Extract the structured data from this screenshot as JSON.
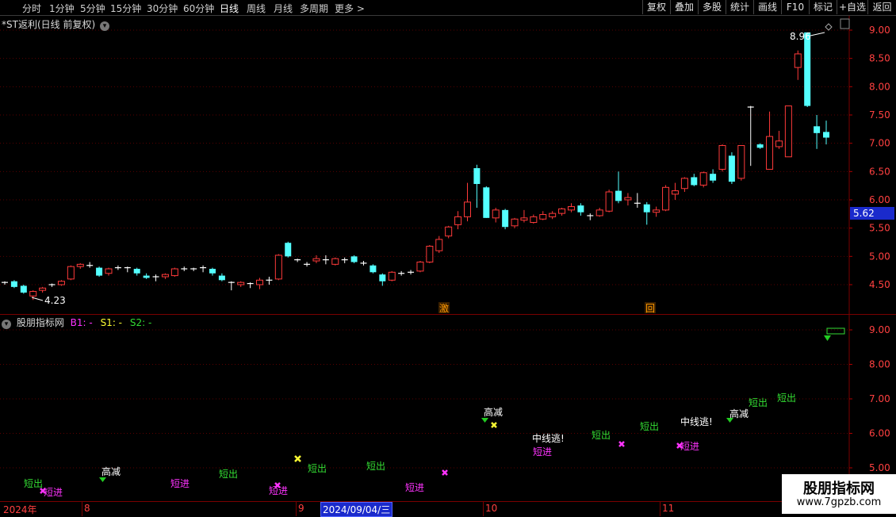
{
  "toolbar": {
    "timeframes": [
      "分时",
      "1分钟",
      "5分钟",
      "15分钟",
      "30分钟",
      "60分钟",
      "日线",
      "周线",
      "月线",
      "多周期",
      "更多 >"
    ],
    "active_timeframe": "日线",
    "buttons": [
      "复权",
      "叠加",
      "多股",
      "统计",
      "画线",
      "F10",
      "标记",
      "+自选",
      "返回"
    ]
  },
  "main_chart": {
    "title": "*ST返利(日线 前复权)",
    "price_ticks": [
      "9.00",
      "8.50",
      "8.00",
      "7.50",
      "7.00",
      "6.50",
      "6.00",
      "5.50",
      "5.00",
      "4.50"
    ],
    "current_price_label": "5.62",
    "high_annotation": "8.96",
    "low_annotation": "4.23",
    "markers": [
      {
        "text": "激",
        "color": "#ff9900"
      },
      {
        "text": "回",
        "color": "#ff9900"
      }
    ]
  },
  "sub_chart": {
    "name": "股朋指标网",
    "b1_label": "B1: -",
    "s1_label": "S1: -",
    "s2_label": "S2: -",
    "ticks": [
      "9.00",
      "8.00",
      "7.00",
      "6.00",
      "5.00"
    ],
    "signals": [
      {
        "text": "短出",
        "color": "#33dd33"
      },
      {
        "text": "短进",
        "color": "#ff33ff"
      },
      {
        "text": "高减",
        "color": "#ffffff"
      },
      {
        "text": "短进",
        "color": "#ff33ff"
      },
      {
        "text": "短出",
        "color": "#33dd33"
      },
      {
        "text": "短进",
        "color": "#ff33ff"
      },
      {
        "text": "短出",
        "color": "#33dd33"
      },
      {
        "text": "短出",
        "color": "#33dd33"
      },
      {
        "text": "短进",
        "color": "#ff33ff"
      },
      {
        "text": "高减",
        "color": "#ffffff"
      },
      {
        "text": "中线逃!",
        "color": "#ffffff"
      },
      {
        "text": "短进",
        "color": "#ff33ff"
      },
      {
        "text": "短出",
        "color": "#33dd33"
      },
      {
        "text": "短出",
        "color": "#33dd33"
      },
      {
        "text": "中线逃!",
        "color": "#ffffff"
      },
      {
        "text": "短进",
        "color": "#ff33ff"
      },
      {
        "text": "高减",
        "color": "#ffffff"
      },
      {
        "text": "短出",
        "color": "#33dd33"
      },
      {
        "text": "短出",
        "color": "#33dd33"
      }
    ]
  },
  "date_axis": {
    "labels": [
      "2024年",
      "8",
      "9",
      "2024/09/04/三",
      "10",
      "11"
    ]
  },
  "watermark": {
    "title": "股朋指标网",
    "url": "www.7gpzb.com"
  },
  "chart_data": {
    "type": "candlestick",
    "ylim": [
      4.2,
      9.2
    ],
    "candles": [
      {
        "o": 4.52,
        "h": 4.56,
        "l": 4.5,
        "c": 4.54
      },
      {
        "o": 4.56,
        "h": 4.58,
        "l": 4.44,
        "c": 4.46
      },
      {
        "o": 4.48,
        "h": 4.5,
        "l": 4.34,
        "c": 4.36
      },
      {
        "o": 4.3,
        "h": 4.4,
        "l": 4.23,
        "c": 4.38
      },
      {
        "o": 4.4,
        "h": 4.46,
        "l": 4.36,
        "c": 4.44
      },
      {
        "o": 4.48,
        "h": 4.52,
        "l": 4.46,
        "c": 4.5
      },
      {
        "o": 4.5,
        "h": 4.58,
        "l": 4.48,
        "c": 4.56
      },
      {
        "o": 4.6,
        "h": 4.84,
        "l": 4.58,
        "c": 4.82
      },
      {
        "o": 4.82,
        "h": 4.88,
        "l": 4.78,
        "c": 4.86
      },
      {
        "o": 4.84,
        "h": 4.9,
        "l": 4.8,
        "c": 4.84
      },
      {
        "o": 4.8,
        "h": 4.82,
        "l": 4.64,
        "c": 4.66
      },
      {
        "o": 4.7,
        "h": 4.8,
        "l": 4.66,
        "c": 4.78
      },
      {
        "o": 4.8,
        "h": 4.84,
        "l": 4.76,
        "c": 4.78
      },
      {
        "o": 4.78,
        "h": 4.82,
        "l": 4.72,
        "c": 4.8
      },
      {
        "o": 4.78,
        "h": 4.8,
        "l": 4.66,
        "c": 4.7
      },
      {
        "o": 4.66,
        "h": 4.7,
        "l": 4.6,
        "c": 4.62
      },
      {
        "o": 4.64,
        "h": 4.68,
        "l": 4.56,
        "c": 4.64
      },
      {
        "o": 4.64,
        "h": 4.7,
        "l": 4.6,
        "c": 4.68
      },
      {
        "o": 4.66,
        "h": 4.8,
        "l": 4.64,
        "c": 4.78
      },
      {
        "o": 4.78,
        "h": 4.82,
        "l": 4.74,
        "c": 4.76
      },
      {
        "o": 4.78,
        "h": 4.8,
        "l": 4.74,
        "c": 4.78
      },
      {
        "o": 4.78,
        "h": 4.84,
        "l": 4.72,
        "c": 4.8
      },
      {
        "o": 4.78,
        "h": 4.8,
        "l": 4.66,
        "c": 4.7
      },
      {
        "o": 4.66,
        "h": 4.7,
        "l": 4.56,
        "c": 4.58
      },
      {
        "o": 4.54,
        "h": 4.56,
        "l": 4.4,
        "c": 4.54
      },
      {
        "o": 4.5,
        "h": 4.56,
        "l": 4.46,
        "c": 4.54
      },
      {
        "o": 4.5,
        "h": 4.54,
        "l": 4.44,
        "c": 4.52
      },
      {
        "o": 4.5,
        "h": 4.62,
        "l": 4.42,
        "c": 4.58
      },
      {
        "o": 4.58,
        "h": 4.64,
        "l": 4.5,
        "c": 4.58
      },
      {
        "o": 4.6,
        "h": 5.04,
        "l": 4.58,
        "c": 5.02
      },
      {
        "o": 5.24,
        "h": 5.26,
        "l": 4.98,
        "c": 5.0
      },
      {
        "o": 4.94,
        "h": 4.96,
        "l": 4.9,
        "c": 4.94
      },
      {
        "o": 4.84,
        "h": 4.9,
        "l": 4.82,
        "c": 4.86
      },
      {
        "o": 4.92,
        "h": 5.02,
        "l": 4.88,
        "c": 4.96
      },
      {
        "o": 4.94,
        "h": 5.02,
        "l": 4.86,
        "c": 4.94
      },
      {
        "o": 4.86,
        "h": 4.98,
        "l": 4.84,
        "c": 4.96
      },
      {
        "o": 4.92,
        "h": 4.98,
        "l": 4.88,
        "c": 4.94
      },
      {
        "o": 5.0,
        "h": 5.02,
        "l": 4.88,
        "c": 4.9
      },
      {
        "o": 4.88,
        "h": 4.92,
        "l": 4.84,
        "c": 4.86
      },
      {
        "o": 4.84,
        "h": 4.86,
        "l": 4.7,
        "c": 4.72
      },
      {
        "o": 4.68,
        "h": 4.7,
        "l": 4.48,
        "c": 4.56
      },
      {
        "o": 4.58,
        "h": 4.74,
        "l": 4.56,
        "c": 4.72
      },
      {
        "o": 4.7,
        "h": 4.74,
        "l": 4.66,
        "c": 4.7
      },
      {
        "o": 4.7,
        "h": 4.76,
        "l": 4.68,
        "c": 4.72
      },
      {
        "o": 4.74,
        "h": 4.92,
        "l": 4.72,
        "c": 4.9
      },
      {
        "o": 4.9,
        "h": 5.2,
        "l": 4.88,
        "c": 5.18
      },
      {
        "o": 5.1,
        "h": 5.36,
        "l": 5.06,
        "c": 5.3
      },
      {
        "o": 5.36,
        "h": 5.54,
        "l": 5.32,
        "c": 5.52
      },
      {
        "o": 5.56,
        "h": 5.8,
        "l": 5.48,
        "c": 5.7
      },
      {
        "o": 5.7,
        "h": 6.3,
        "l": 5.62,
        "c": 5.96
      },
      {
        "o": 6.56,
        "h": 6.62,
        "l": 5.86,
        "c": 6.28
      },
      {
        "o": 6.22,
        "h": 6.24,
        "l": 5.68,
        "c": 5.68
      },
      {
        "o": 5.68,
        "h": 5.86,
        "l": 5.6,
        "c": 5.82
      },
      {
        "o": 5.82,
        "h": 5.84,
        "l": 5.48,
        "c": 5.52
      },
      {
        "o": 5.54,
        "h": 5.68,
        "l": 5.5,
        "c": 5.66
      },
      {
        "o": 5.64,
        "h": 5.82,
        "l": 5.6,
        "c": 5.68
      },
      {
        "o": 5.6,
        "h": 5.74,
        "l": 5.58,
        "c": 5.7
      },
      {
        "o": 5.66,
        "h": 5.8,
        "l": 5.64,
        "c": 5.74
      },
      {
        "o": 5.7,
        "h": 5.8,
        "l": 5.66,
        "c": 5.76
      },
      {
        "o": 5.76,
        "h": 5.86,
        "l": 5.72,
        "c": 5.84
      },
      {
        "o": 5.82,
        "h": 5.94,
        "l": 5.78,
        "c": 5.88
      },
      {
        "o": 5.9,
        "h": 5.94,
        "l": 5.72,
        "c": 5.78
      },
      {
        "o": 5.72,
        "h": 5.76,
        "l": 5.64,
        "c": 5.72
      },
      {
        "o": 5.72,
        "h": 5.86,
        "l": 5.7,
        "c": 5.82
      },
      {
        "o": 5.8,
        "h": 6.18,
        "l": 5.78,
        "c": 6.14
      },
      {
        "o": 6.16,
        "h": 6.5,
        "l": 5.94,
        "c": 5.98
      },
      {
        "o": 6.0,
        "h": 6.12,
        "l": 5.9,
        "c": 6.04
      },
      {
        "o": 5.94,
        "h": 6.12,
        "l": 5.86,
        "c": 5.94
      },
      {
        "o": 5.92,
        "h": 5.96,
        "l": 5.56,
        "c": 5.78
      },
      {
        "o": 5.78,
        "h": 5.88,
        "l": 5.7,
        "c": 5.82
      },
      {
        "o": 5.82,
        "h": 6.26,
        "l": 5.8,
        "c": 6.22
      },
      {
        "o": 6.1,
        "h": 6.3,
        "l": 6.0,
        "c": 6.16
      },
      {
        "o": 6.2,
        "h": 6.4,
        "l": 6.14,
        "c": 6.38
      },
      {
        "o": 6.4,
        "h": 6.46,
        "l": 6.24,
        "c": 6.26
      },
      {
        "o": 6.26,
        "h": 6.5,
        "l": 6.22,
        "c": 6.48
      },
      {
        "o": 6.46,
        "h": 6.54,
        "l": 6.3,
        "c": 6.34
      },
      {
        "o": 6.54,
        "h": 6.98,
        "l": 6.5,
        "c": 6.96
      },
      {
        "o": 6.78,
        "h": 6.84,
        "l": 6.28,
        "c": 6.32
      },
      {
        "o": 6.38,
        "h": 6.96,
        "l": 6.34,
        "c": 6.96
      },
      {
        "o": 7.64,
        "h": 7.66,
        "l": 6.6,
        "c": 7.64
      },
      {
        "o": 6.98,
        "h": 7.0,
        "l": 6.9,
        "c": 6.92
      },
      {
        "o": 6.54,
        "h": 7.56,
        "l": 6.54,
        "c": 7.12
      },
      {
        "o": 6.94,
        "h": 7.22,
        "l": 6.9,
        "c": 7.04
      },
      {
        "o": 6.76,
        "h": 7.64,
        "l": 6.76,
        "c": 7.66
      },
      {
        "o": 8.34,
        "h": 8.64,
        "l": 8.12,
        "c": 8.58
      },
      {
        "o": 8.96,
        "h": 8.96,
        "l": 7.64,
        "c": 7.66
      },
      {
        "o": 7.3,
        "h": 7.5,
        "l": 6.9,
        "c": 7.18
      },
      {
        "o": 7.2,
        "h": 7.4,
        "l": 6.98,
        "c": 7.1
      }
    ]
  }
}
